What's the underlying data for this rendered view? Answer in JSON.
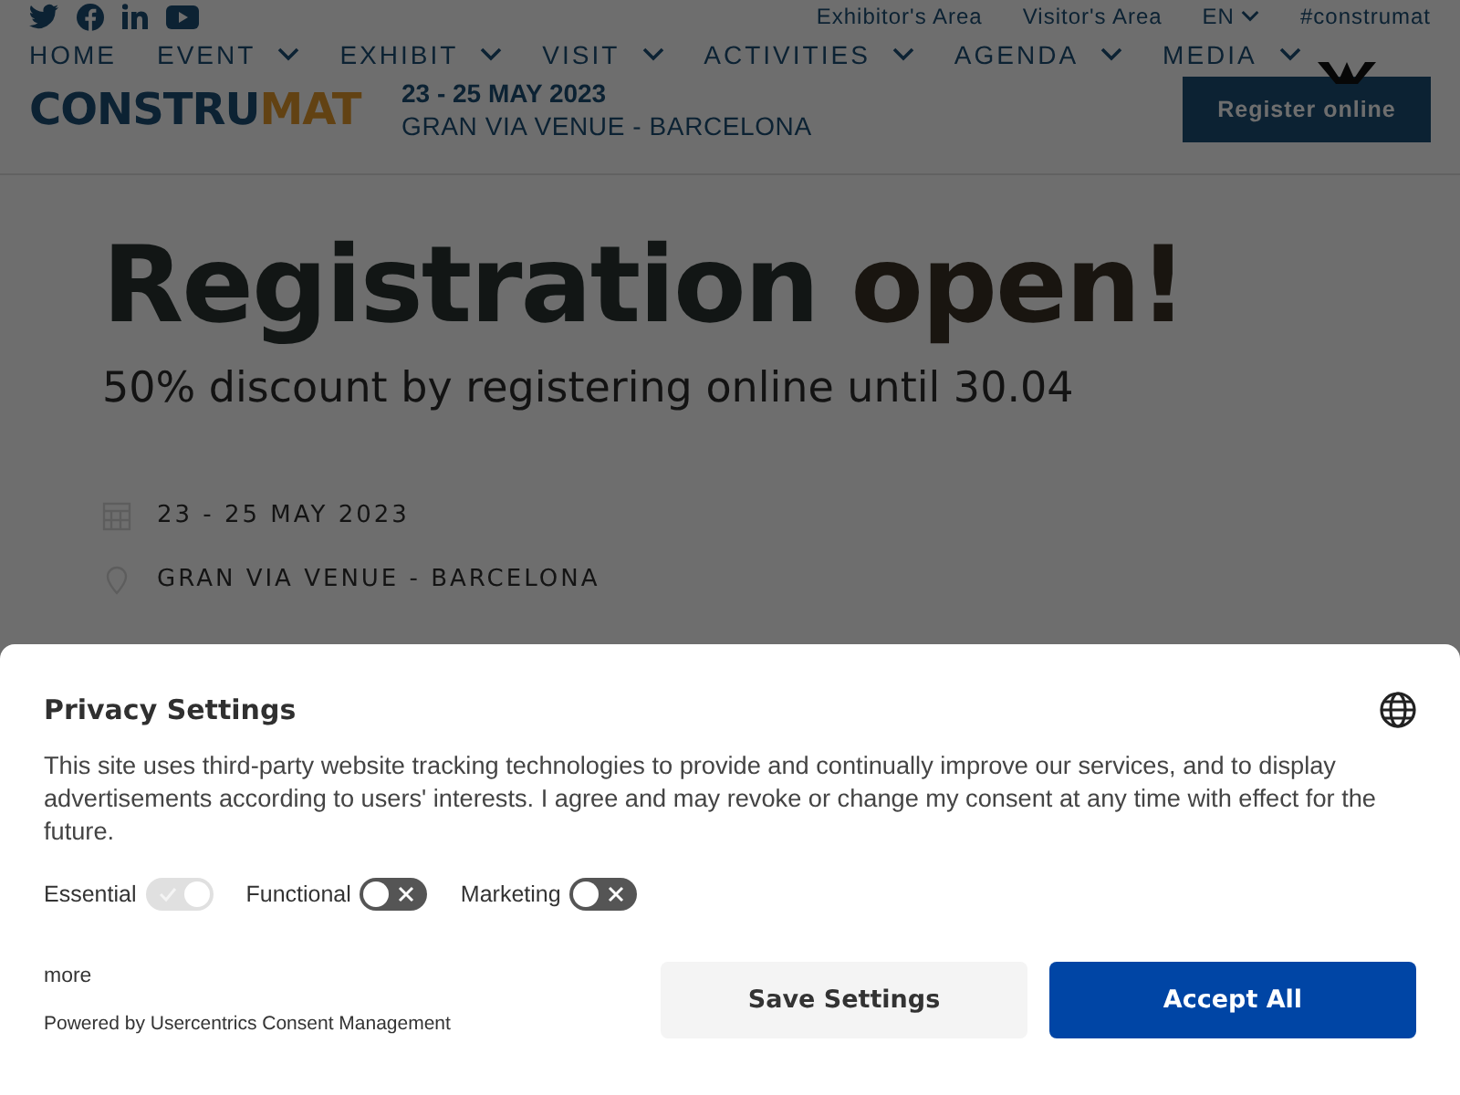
{
  "header": {
    "social_links": [
      {
        "kind": "twitter"
      },
      {
        "kind": "facebook"
      },
      {
        "kind": "linkedin"
      },
      {
        "kind": "youtube"
      }
    ],
    "utility_links": [
      {
        "label": "Exhibitor's Area",
        "dropdown": false
      },
      {
        "label": "Visitor's Area",
        "dropdown": false
      },
      {
        "label": "EN",
        "dropdown": true
      },
      {
        "label": "#construmat",
        "dropdown": false
      }
    ],
    "nav": [
      {
        "label": "HOME",
        "dropdown": false
      },
      {
        "label": "EVENT",
        "dropdown": true
      },
      {
        "label": "EXHIBIT",
        "dropdown": true
      },
      {
        "label": "VISIT",
        "dropdown": true
      },
      {
        "label": "ACTIVITIES",
        "dropdown": true
      },
      {
        "label": "AGENDA",
        "dropdown": true
      },
      {
        "label": "MEDIA",
        "dropdown": true
      }
    ],
    "logo": {
      "part_1": "CONSTRU",
      "part_2": "MAT"
    },
    "dates": "23 - 25 MAY 2023",
    "venue": "GRAN VIA VENUE - BARCELONA",
    "register_button": "Register online"
  },
  "hero": {
    "title_1": "Registration",
    "title_2": "open!",
    "subtitle": "50% discount by registering online until 30.04",
    "dates": "23 - 25 MAY 2023",
    "venue": "GRAN VIA VENUE - BARCELONA"
  },
  "consent_banner": {
    "title": "Privacy Settings",
    "text": "This site uses third-party website tracking technologies to provide and continually improve our services, and to display advertisements according to users' interests. I agree and may revoke or change my consent at any time with effect for the future.",
    "consents": [
      {
        "label": "Essential",
        "checked": true,
        "disabled": true
      },
      {
        "label": "Functional",
        "checked": false,
        "disabled": false
      },
      {
        "label": "Marketing",
        "checked": false,
        "disabled": false
      }
    ],
    "more_link": "more",
    "powered_by": "Powered by Usercentrics Consent Management",
    "buttons": [
      {
        "label": "Save Settings",
        "kind": "secondary"
      },
      {
        "label": "Accept All",
        "kind": "primary"
      }
    ]
  }
}
